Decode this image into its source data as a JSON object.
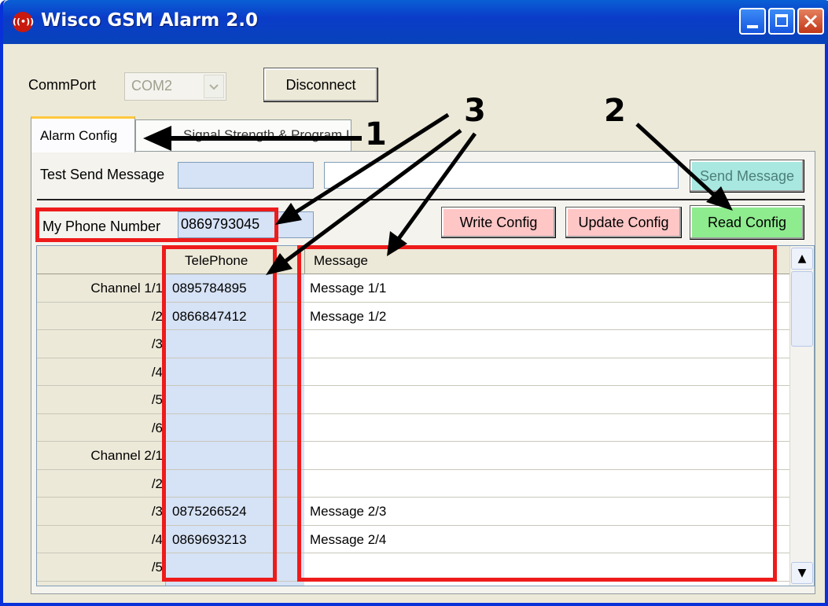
{
  "window": {
    "title": "Wisco GSM Alarm 2.0",
    "icon": "app-logo-icon"
  },
  "commport": {
    "label": "CommPort",
    "value": "COM2",
    "disconnect_label": "Disconnect"
  },
  "tabs": [
    {
      "label": "Alarm Config",
      "active": true
    },
    {
      "label": "Signal Strength & Program Log",
      "active": false
    }
  ],
  "test_send": {
    "label": "Test Send Message",
    "phone": "",
    "message": "",
    "button_label": "Send Message"
  },
  "my_phone": {
    "label": "My Phone Number",
    "value": "0869793045"
  },
  "buttons": {
    "write": "Write Config",
    "update": "Update Config",
    "read": "Read Config"
  },
  "grid": {
    "headers": [
      "TelePhone",
      "Message"
    ],
    "rows": [
      {
        "channel": "Channel 1/1",
        "phone": "0895784895",
        "message": "Message 1/1"
      },
      {
        "channel": "/2",
        "phone": "0866847412",
        "message": "Message 1/2"
      },
      {
        "channel": "/3",
        "phone": "",
        "message": ""
      },
      {
        "channel": "/4",
        "phone": "",
        "message": ""
      },
      {
        "channel": "/5",
        "phone": "",
        "message": ""
      },
      {
        "channel": "/6",
        "phone": "",
        "message": ""
      },
      {
        "channel": "Channel 2/1",
        "phone": "",
        "message": ""
      },
      {
        "channel": "/2",
        "phone": "",
        "message": ""
      },
      {
        "channel": "/3",
        "phone": "0875266524",
        "message": "Message 2/3"
      },
      {
        "channel": "/4",
        "phone": "0869693213",
        "message": "Message 2/4"
      },
      {
        "channel": "/5",
        "phone": "",
        "message": ""
      }
    ]
  },
  "callouts": [
    "1",
    "2",
    "3"
  ],
  "colors": {
    "titlebar": "#0A4FD0",
    "field_blue": "#D6E2F5",
    "write_btn": "#FFC6C6",
    "update_btn": "#FFC6C6",
    "read_btn": "#8EEB8E",
    "send_btn": "#A8E8E0",
    "highlight_red": "#EE1B1B"
  }
}
